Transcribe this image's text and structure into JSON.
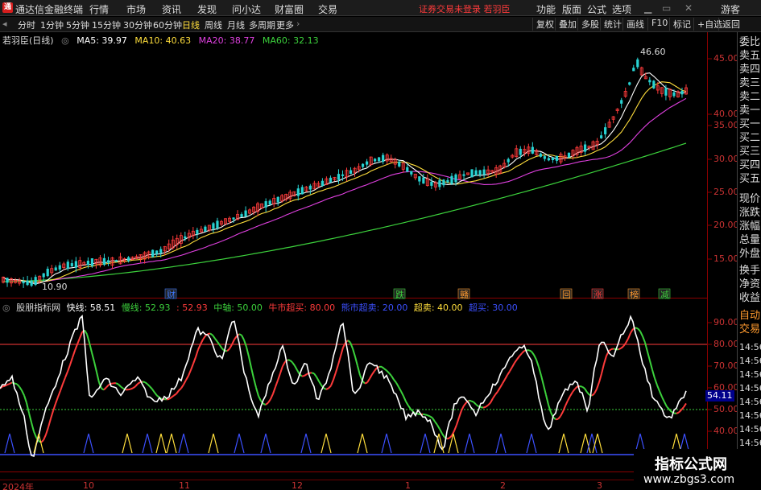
{
  "titlebar": {
    "app_name": "通达信金融终端",
    "menus": [
      "行情",
      "市场",
      "资讯",
      "发现",
      "问小达",
      "财富圈",
      "交易"
    ],
    "notice": "证券交易未登录  若羽臣",
    "right_menus": [
      "功能",
      "版面",
      "公式",
      "选项"
    ],
    "user": "游客"
  },
  "toolbar": {
    "periods": [
      "分时",
      "1分钟",
      "5分钟",
      "15分钟",
      "30分钟",
      "60分钟",
      "日线",
      "周线",
      "月线",
      "多周期",
      "更多"
    ],
    "active_period": "日线",
    "buttons": [
      "复权",
      "叠加",
      "多股",
      "统计",
      "画线",
      "F10",
      "标记",
      "+自选",
      "返回"
    ]
  },
  "main_chart": {
    "stock_title": "若羽臣(日线)",
    "ma_legend": [
      {
        "label": "MA5: 39.97",
        "color": "#ffffff"
      },
      {
        "label": "MA10: 40.63",
        "color": "#ffde3c"
      },
      {
        "label": "MA20: 38.77",
        "color": "#e040e0"
      },
      {
        "label": "MA60: 32.13",
        "color": "#3cd23c"
      }
    ],
    "high_label": "46.60",
    "low_label": "10.90",
    "y_ticks": [
      "45.00",
      "40.00",
      "35.00",
      "30.00",
      "25.00",
      "20.00",
      "15.00"
    ],
    "event_markers": [
      {
        "text": "财",
        "color": "#3c78ff"
      },
      {
        "text": "跌",
        "color": "#3cd23c"
      },
      {
        "text": "赣",
        "color": "#ff9a2e"
      },
      {
        "text": "回",
        "color": "#ff9a2e"
      },
      {
        "text": "涨",
        "color": "#ff3b3b"
      },
      {
        "text": "榜",
        "color": "#ff9a2e"
      },
      {
        "text": "减",
        "color": "#3cd23c"
      }
    ]
  },
  "indicator": {
    "name": "股朋指标网",
    "legend": [
      {
        "label": "快线: 58.51",
        "color": "#ffffff"
      },
      {
        "label": "慢线: 52.93",
        "color": "#3cd23c"
      },
      {
        "label": ": 52.93",
        "color": "#ff3b3b"
      },
      {
        "label": "中轴: 50.00",
        "color": "#3cd23c"
      },
      {
        "label": "牛市超买: 80.00",
        "color": "#ff3b3b"
      },
      {
        "label": "熊市超卖: 20.00",
        "color": "#3c50ff"
      },
      {
        "label": "超卖: 40.00",
        "color": "#ffde3c"
      },
      {
        "label": "超买: 30.00",
        "color": "#3c50ff"
      }
    ],
    "y_ticks": [
      "90.00",
      "80.00",
      "70.00",
      "60.00",
      "50.00",
      "40.00"
    ],
    "current_value": "54.11"
  },
  "date_axis": [
    "2024年",
    "10",
    "11",
    "12",
    "1",
    "2",
    "3"
  ],
  "right_panel": {
    "items": [
      "委比",
      "卖五",
      "卖四",
      "卖三",
      "卖二",
      "卖一",
      "买一",
      "买二",
      "买三",
      "买四",
      "买五",
      "现价",
      "涨跌",
      "涨幅",
      "总量",
      "外盘",
      "换手",
      "净资",
      "收益"
    ],
    "bottom_items": [
      "自动",
      "交易"
    ],
    "times": [
      "14:56",
      "14:56",
      "14:56",
      "14:56",
      "14:56",
      "14:56",
      "14:56",
      "14:56"
    ]
  },
  "watermark": {
    "title": "指标公式网",
    "url": "www.zbgs3.com"
  },
  "colors": {
    "up": "#ff3b3b",
    "down": "#28d2d2",
    "ma5": "#ffffff",
    "ma10": "#ffde3c",
    "ma20": "#e040e0",
    "ma60": "#3cd23c",
    "grid": "#8b0000"
  }
}
